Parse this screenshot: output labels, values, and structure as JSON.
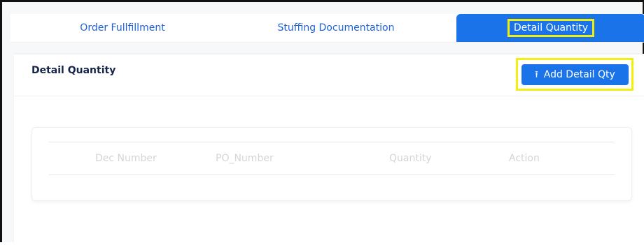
{
  "tabs": {
    "order_fulfillment": "Order Fullfillment",
    "stuffing_documentation": "Stuffing Documentation",
    "detail_quantity": "Detail Quantity",
    "active": "Detail Quantity"
  },
  "card": {
    "title": "Detail Quantity",
    "add_button_label": "Add Detail Qty",
    "add_button_icon": "upload-icon"
  },
  "table": {
    "columns": [
      "Dec Number",
      "PO_Number",
      "Quantity",
      "Action"
    ],
    "rows": []
  },
  "colors": {
    "accent": "#1a73e8",
    "highlight": "#f2ee12"
  }
}
